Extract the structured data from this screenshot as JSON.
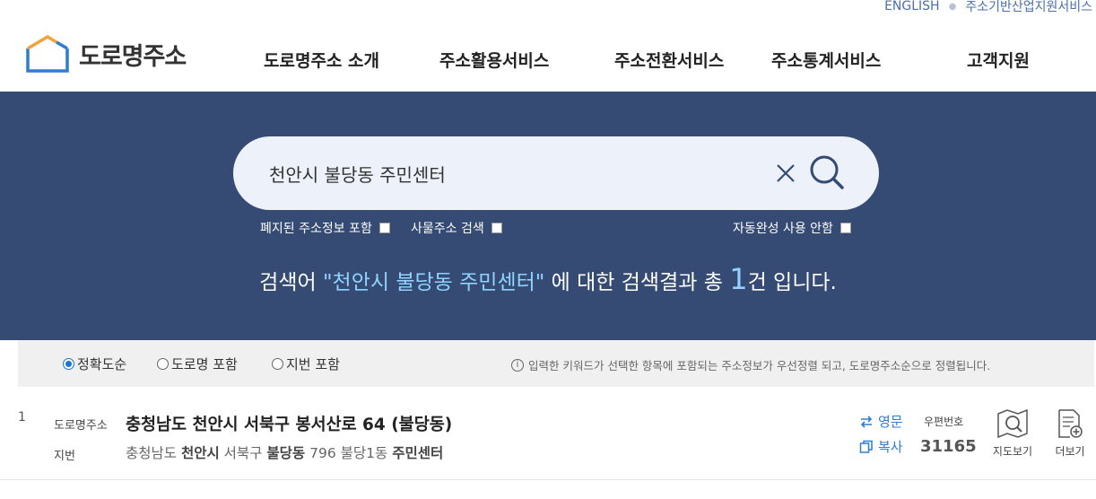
{
  "util_links": [
    "ENGLISH",
    "주소기반산업지원서비스"
  ],
  "logo": {
    "text": "도로명주소"
  },
  "nav": [
    "도로명주소 소개",
    "주소활용서비스",
    "주소전환서비스",
    "주소통계서비스",
    "고객지원"
  ],
  "search": {
    "value": "천안시 불당동 주민센터",
    "options": {
      "abolished": "폐지된 주소정보 포함",
      "object": "사물주소 검색",
      "autocomplete_off": "자동완성 사용 안함"
    },
    "result_prefix": "검색어 ",
    "result_keyword": "\"천안시 불당동 주민센터\"",
    "result_mid": " 에 대한 검색결과 총 ",
    "result_count": "1",
    "result_suffix": "건 입니다."
  },
  "sort": {
    "options": [
      "정확도순",
      "도로명 포함",
      "지번 포함"
    ],
    "selected": 0,
    "note": "입력한 키워드가 선택한 항목에 포함되는 주소정보가 우선정렬 되고, 도로명주소순으로 정렬됩니다."
  },
  "results": [
    {
      "num": "1",
      "road_label": "도로명주소",
      "road_address": "충청남도 천안시 서북구 봉서산로 64 (불당동)",
      "jibun_label": "지번",
      "jibun_parts": [
        "충청남도 ",
        "천안시",
        " 서북구 ",
        "불당동",
        " 796 불당1동 ",
        "주민센터"
      ],
      "english_label": "영문",
      "copy_label": "복사",
      "zip_label": "우편번호",
      "zip": "31165",
      "map_label": "지도보기",
      "more_label": "더보기"
    }
  ],
  "colors": {
    "hero_bg": "#354b73",
    "accent": "#2f7dd1",
    "highlight": "#8fd3ff"
  }
}
